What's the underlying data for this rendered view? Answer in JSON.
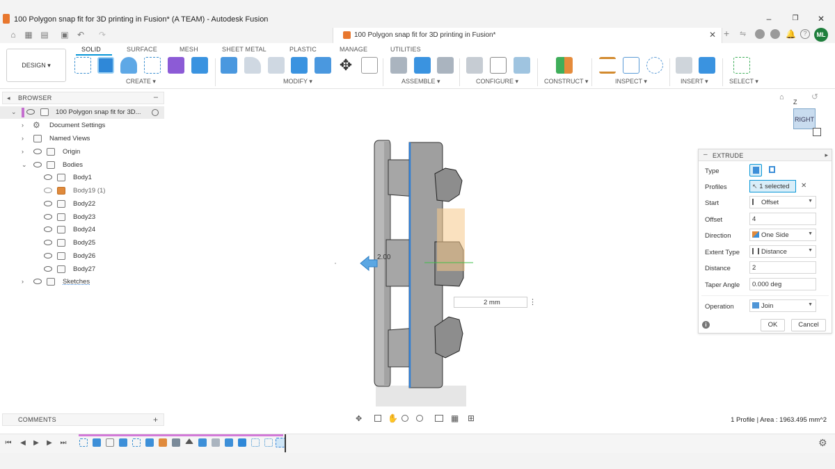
{
  "window": {
    "title": "100 Polygon snap fit for 3D printing in Fusion* (A TEAM) - Autodesk Fusion",
    "controls": {
      "minimize": "–",
      "maximize": "❐",
      "close": "✕"
    }
  },
  "document_tab": {
    "title": "100 Polygon snap fit for 3D printing in Fusion*",
    "close": "✕"
  },
  "user": {
    "initials": "ML"
  },
  "workspace": {
    "label": "DESIGN ▾"
  },
  "ribbon_tabs": [
    "SOLID",
    "SURFACE",
    "MESH",
    "SHEET METAL",
    "PLASTIC",
    "MANAGE",
    "UTILITIES"
  ],
  "ribbon_groups": [
    "CREATE ▾",
    "MODIFY ▾",
    "ASSEMBLE ▾",
    "CONFIGURE ▾",
    "CONSTRUCT ▾",
    "INSPECT ▾",
    "INSERT ▾",
    "SELECT ▾"
  ],
  "browser": {
    "title": "BROWSER",
    "collapse": "–",
    "root": "100 Polygon snap fit for 3D...",
    "items": [
      {
        "label": "Document Settings"
      },
      {
        "label": "Named Views"
      },
      {
        "label": "Origin"
      },
      {
        "label": "Bodies"
      },
      {
        "label": "Body1"
      },
      {
        "label": "Body19 (1)"
      },
      {
        "label": "Body22"
      },
      {
        "label": "Body23"
      },
      {
        "label": "Body24"
      },
      {
        "label": "Body25"
      },
      {
        "label": "Body26"
      },
      {
        "label": "Body27"
      },
      {
        "label": "Sketches"
      }
    ]
  },
  "viewcube": {
    "face": "RIGHT",
    "axis_z": "Z"
  },
  "viewport": {
    "dimension_label": "2.00",
    "distance_input": "2 mm",
    "menu": "⋮"
  },
  "extrude": {
    "title": "EXTRUDE",
    "expand": "▸",
    "rows": {
      "type": {
        "label": "Type"
      },
      "profiles": {
        "label": "Profiles",
        "value": "1 selected",
        "clear": "✕"
      },
      "start": {
        "label": "Start",
        "value": "Offset"
      },
      "offset": {
        "label": "Offset",
        "value": "4"
      },
      "direction": {
        "label": "Direction",
        "value": "One Side"
      },
      "extent_type": {
        "label": "Extent Type",
        "value": "Distance"
      },
      "distance": {
        "label": "Distance",
        "value": "2"
      },
      "taper_angle": {
        "label": "Taper Angle",
        "value": "0.000 deg"
      },
      "operation": {
        "label": "Operation",
        "value": "Join"
      }
    },
    "ok": "OK",
    "cancel": "Cancel"
  },
  "comments": {
    "title": "COMMENTS",
    "add": "+"
  },
  "status": {
    "text": "1 Profile | Area : 1963.495 mm^2"
  },
  "colors": {
    "accent": "#0696d7",
    "highlight": "#f5c98a",
    "user_avatar": "#1e7e3c"
  }
}
